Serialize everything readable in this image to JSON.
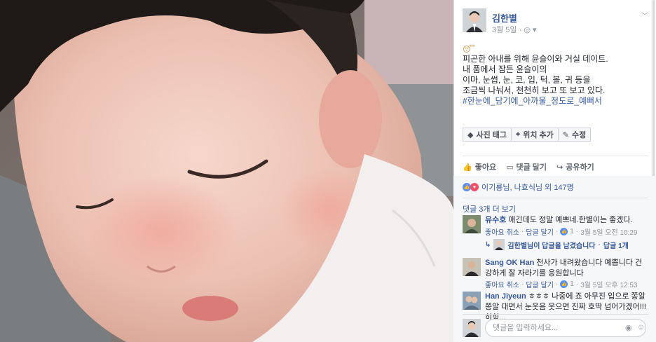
{
  "post": {
    "author": "김한별",
    "date": "3월 5일",
    "meta_sep": "·",
    "emoji": "😴",
    "lines": [
      "피곤한 아내를 위해 윤슬이와 거실 데이트.",
      "내 품에서 잠든 윤슬이의",
      "이마, 눈썹, 눈, 코, 입, 턱, 볼, 귀 등을",
      "조금씩 나눠서, 천천히 보고 또 보고 있다."
    ],
    "hashtag": "#한눈에_담기에_아까울_정도로_예뻐서"
  },
  "chips": {
    "tag_photo": "사진 태그",
    "location": "위치 추가",
    "edit": "수정"
  },
  "actions": {
    "like": "좋아요",
    "comment": "댓글 달기",
    "share": "공유하기"
  },
  "reactions": {
    "summary": "이기룡님, 나효식님 외 147명"
  },
  "more_comments": "댓글 3개 더 보기",
  "comments": [
    {
      "name": "유수호",
      "text": "애긴데도 정말 예쁘네.한별이는 좋겠다.",
      "like": "좋아요",
      "cancel": "취소",
      "reply": "답글 달기",
      "count": "1",
      "time": "3월 5일 오전 10:29"
    },
    {
      "name": "Sang OK Han",
      "text": "천사가 내려왔습니다 예쁩니다 건강하게 잘 자라기를 응원합니다",
      "like": "좋아요",
      "cancel": "취소",
      "reply": "답글 달기",
      "count": "1",
      "time": "3월 5일 오후 12:53"
    },
    {
      "name": "Han Jiyeun",
      "text": "ㅎㅎㅎ 나중에 죠 아무진 입으로 쫑알쫑알 대면서 눈웃음 웃으면 진짜 호딱 넘어가겠어!!! 히힝..."
    }
  ],
  "reply_summary": {
    "text": "김한별님이 답글을 남겼습니다",
    "sep": "·",
    "count": "답글 1개"
  },
  "composer": {
    "placeholder": "댓글을 입력하세요..."
  },
  "icons": {
    "globe": "globe-icon",
    "chevron": "chevron-down-icon",
    "tag": "tag-icon",
    "pin": "location-pin-icon",
    "pencil": "pencil-icon",
    "like": "thumbs-up-icon",
    "comment": "comment-icon",
    "share": "share-icon",
    "camera": "camera-icon",
    "sticker": "sticker-icon"
  },
  "colors": {
    "link": "#365899",
    "like_blue": "#5890ff",
    "love_red": "#f25268",
    "text": "#1d2129",
    "muted": "#90949c"
  }
}
